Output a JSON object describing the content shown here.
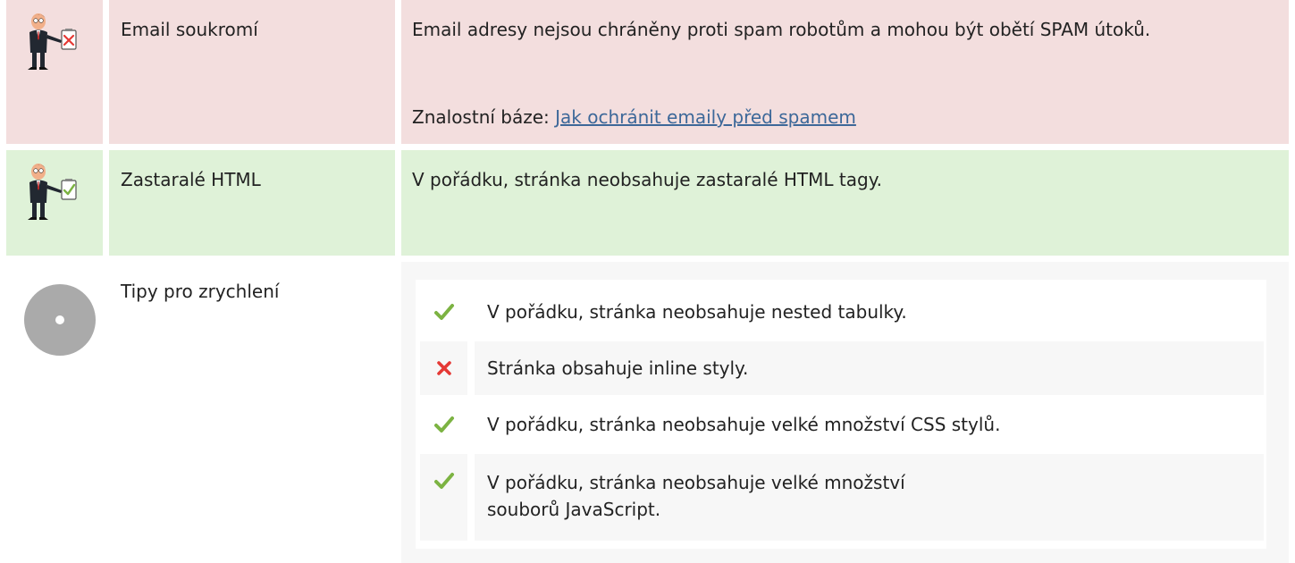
{
  "rows": [
    {
      "status": "bad",
      "icon": "man-holding-red-cross-clipboard-icon",
      "label": "Email soukromí",
      "text": "Email adresy nejsou chráněny proti spam robotům a mohou být obětí SPAM útoků.",
      "kb_prefix": "Znalostní báze: ",
      "kb_link": "Jak ochránit emaily před spamem"
    },
    {
      "status": "good",
      "icon": "man-holding-green-check-clipboard-icon",
      "label": "Zastaralé HTML",
      "text": "V pořádku, stránka neobsahuje zastaralé HTML tagy."
    },
    {
      "status": "neutral",
      "icon": "gray-disc-icon",
      "label": "Tipy pro zrychlení",
      "tips": [
        {
          "status": "ok",
          "icon": "green-check-icon",
          "text": "V pořádku, stránka neobsahuje nested tabulky."
        },
        {
          "status": "fail",
          "icon": "red-cross-icon",
          "text": "Stránka obsahuje inline styly."
        },
        {
          "status": "ok",
          "icon": "green-check-icon",
          "text": "V pořádku, stránka neobsahuje velké množství CSS stylů."
        },
        {
          "status": "ok",
          "icon": "green-check-icon",
          "text": "V pořádku, stránka neobsahuje velké množství souborů JavaScript."
        }
      ]
    }
  ],
  "colors": {
    "bad_bg": "#f3dede",
    "good_bg": "#dff2d8",
    "link": "#3d6899",
    "check_green": "#7cb342",
    "cross_red": "#e53935"
  }
}
